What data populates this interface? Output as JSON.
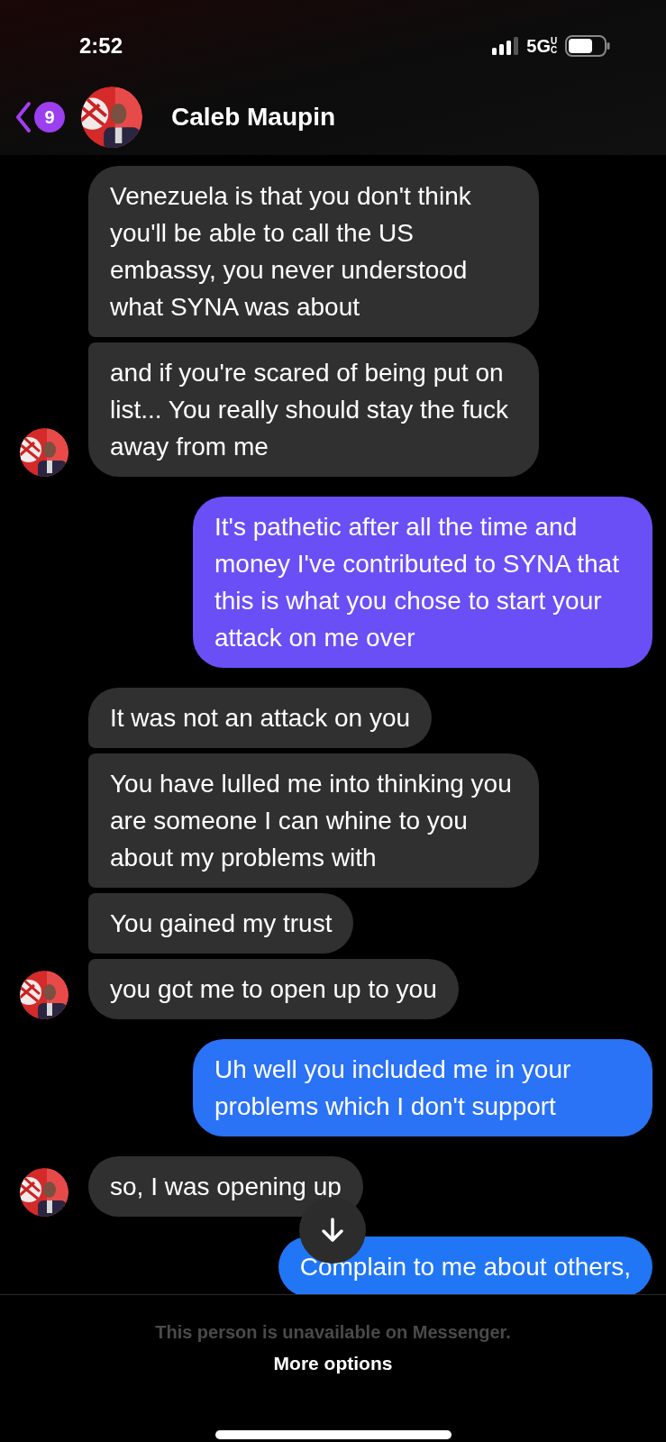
{
  "status_bar": {
    "time": "2:52",
    "network": "5G",
    "network_sub": "UC"
  },
  "header": {
    "back_badge": "9",
    "title": "Caleb Maupin"
  },
  "messages": [
    {
      "kind": "received",
      "text": "Venezuela is that you don't think you'll be able to call the US embassy, you never understood what SYNA was about",
      "avatar": false
    },
    {
      "kind": "received",
      "text": "and if you're scared of being put on list... You really should stay the fuck away from me",
      "avatar": true
    },
    {
      "kind": "sent",
      "text": "It's pathetic after all the time and money I've contributed to SYNA that this is what you chose to start your attack on me over",
      "color": "#6a4ff6"
    },
    {
      "kind": "received",
      "text": "It was not an attack on you",
      "avatar": false
    },
    {
      "kind": "received",
      "text": "You have lulled me into thinking you are someone I can whine to you about my problems with",
      "avatar": false
    },
    {
      "kind": "received",
      "text": "You gained my trust",
      "avatar": false
    },
    {
      "kind": "received",
      "text": "you got me to open up to you",
      "avatar": true
    },
    {
      "kind": "sent",
      "text": "Uh well you included me in your problems which I don't support",
      "color": "#2a72f6"
    },
    {
      "kind": "received",
      "text": "so, I was opening up",
      "avatar": true
    },
    {
      "kind": "sent",
      "text": "Complain to me about others,",
      "color": "#2176f6"
    }
  ],
  "footer": {
    "notice": "This person is unavailable on Messenger.",
    "action": "More options"
  }
}
